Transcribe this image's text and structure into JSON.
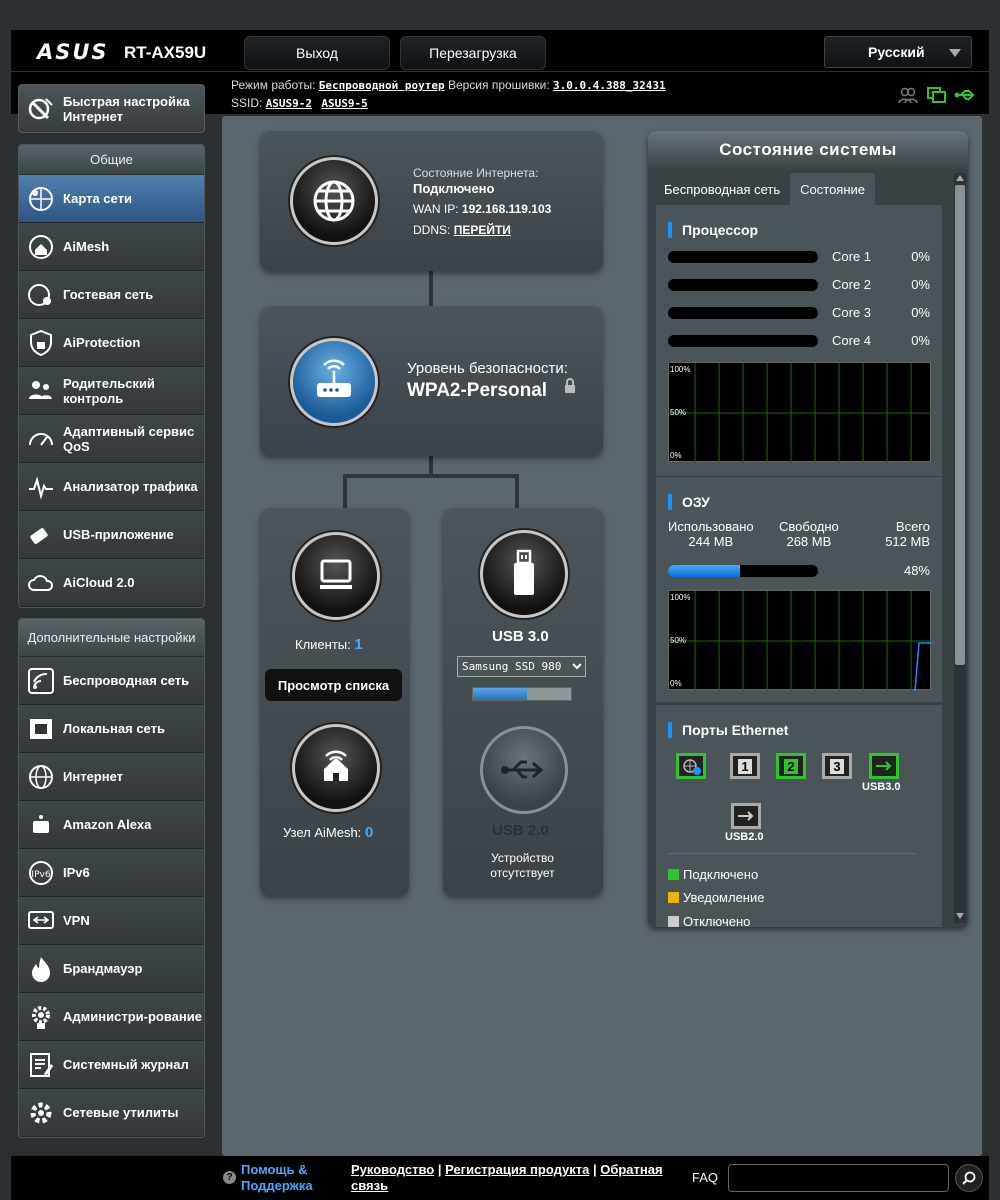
{
  "header": {
    "logo": "ASUS",
    "model": "RT-AX59U",
    "logout": "Выход",
    "reboot": "Перезагрузка",
    "language": "Русский"
  },
  "info": {
    "mode_label": "Режим работы:",
    "mode_value": "Беспроводной роутер",
    "fw_label": "Версия прошивки:",
    "fw_value": "3.0.0.4.388_32431",
    "ssid_label": "SSID:",
    "ssid1": "ASUS9-2",
    "ssid2": "ASUS9-5"
  },
  "sidebar": {
    "quick": "Быстрая настройка Интернет",
    "general_head": "Общие",
    "general": [
      {
        "label": "Карта сети",
        "icon": "network-map-icon"
      },
      {
        "label": "AiMesh",
        "icon": "aimesh-icon"
      },
      {
        "label": "Гостевая сеть",
        "icon": "guest-network-icon"
      },
      {
        "label": "AiProtection",
        "icon": "shield-lock-icon"
      },
      {
        "label": "Родительский контроль",
        "icon": "parental-control-icon"
      },
      {
        "label": "Адаптивный сервис QoS",
        "icon": "gauge-icon"
      },
      {
        "label": "Анализатор трафика",
        "icon": "traffic-analyzer-icon"
      },
      {
        "label": "USB-приложение",
        "icon": "usb-app-icon"
      },
      {
        "label": "AiCloud 2.0",
        "icon": "cloud-icon"
      }
    ],
    "advanced_head": "Дополнительные настройки",
    "advanced": [
      {
        "label": "Беспроводная сеть",
        "icon": "wireless-icon"
      },
      {
        "label": "Локальная сеть",
        "icon": "lan-icon"
      },
      {
        "label": "Интернет",
        "icon": "globe-icon"
      },
      {
        "label": "Amazon Alexa",
        "icon": "alexa-icon"
      },
      {
        "label": "IPv6",
        "icon": "ipv6-icon"
      },
      {
        "label": "VPN",
        "icon": "vpn-icon"
      },
      {
        "label": "Брандмауэр",
        "icon": "firewall-icon"
      },
      {
        "label": "Администри-рование",
        "icon": "admin-gear-icon"
      },
      {
        "label": "Системный журнал",
        "icon": "system-log-icon"
      },
      {
        "label": "Сетевые утилиты",
        "icon": "network-tools-icon"
      }
    ]
  },
  "map": {
    "internet_status_label": "Состояние Интернета:",
    "internet_status": "Подключено",
    "wan_label": "WAN IP:",
    "wan_ip": "192.168.119.103",
    "ddns_label": "DDNS:",
    "ddns_link": "ПЕРЕЙТИ",
    "security_label": "Уровень безопасности:",
    "security_value": "WPA2-Personal",
    "clients_label": "Клиенты:",
    "clients_count": "1",
    "view_list": "Просмотр списка",
    "aimesh_label": "Узел AiMesh:",
    "aimesh_count": "0",
    "usb3_label": "USB 3.0",
    "usb3_device": "Samsung SSD 980",
    "usb3_usage": 0.55,
    "usb2_label": "USB 2.0",
    "usb2_status": "Устройство отсутствует"
  },
  "system": {
    "title": "Состояние системы",
    "tab_wireless": "Беспроводная сеть",
    "tab_status": "Состояние",
    "cpu_title": "Процессор",
    "cores": [
      {
        "name": "Core 1",
        "pct": "0%",
        "value": 0
      },
      {
        "name": "Core 2",
        "pct": "0%",
        "value": 0
      },
      {
        "name": "Core 3",
        "pct": "0%",
        "value": 0
      },
      {
        "name": "Core 4",
        "pct": "0%",
        "value": 0
      }
    ],
    "graph_100": "100%",
    "graph_50": "50%",
    "graph_0": "0%",
    "ram_title": "ОЗУ",
    "ram_used_label": "Использовано",
    "ram_free_label": "Свободно",
    "ram_total_label": "Всего",
    "ram_used": "244 MB",
    "ram_free": "268 MB",
    "ram_total": "512 MB",
    "ram_pct": "48%",
    "ram_value": 0.48,
    "eth_title": "Порты Ethernet",
    "ports": [
      "1",
      "2",
      "3"
    ],
    "usb3_port": "USB3.0",
    "usb2_port": "USB2.0",
    "legend_connected": "Подключено",
    "legend_warning": "Уведомление",
    "legend_disconnected": "Отключено",
    "colors": {
      "connected": "#2fc52f",
      "warning": "#e8b400",
      "disconnected": "#cccccc",
      "accent": "#1e90ff"
    }
  },
  "footer": {
    "help": "Помощь & Поддержка",
    "manual": "Руководство",
    "registration": "Регистрация продукта",
    "feedback": "Обратная связь",
    "faq": "FAQ"
  }
}
